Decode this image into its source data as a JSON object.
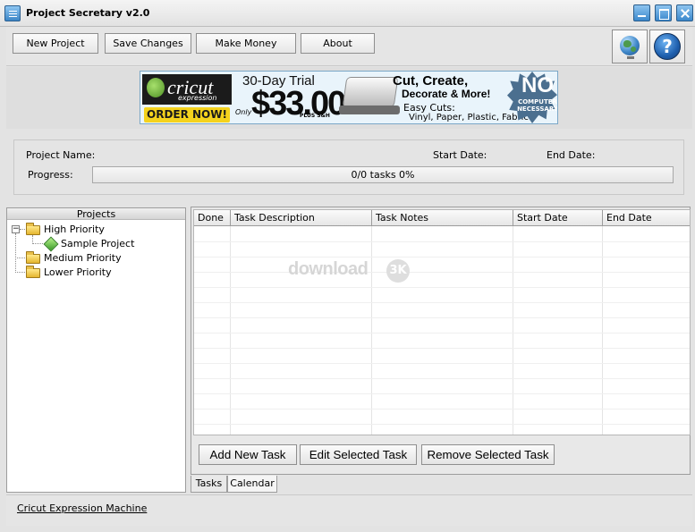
{
  "window": {
    "title": "Project Secretary v2.0"
  },
  "toolbar": {
    "new_project": "New Project",
    "save_changes": "Save Changes",
    "make_money": "Make Money",
    "about": "About",
    "help_glyph": "?",
    "icons": [
      "globe-icon",
      "help-icon"
    ]
  },
  "banner": {
    "brand": "cricut",
    "brand_sub": "expression",
    "order_now": "ORDER NOW!",
    "trial": "30-Day Trial",
    "only": "Only",
    "price": "$33.00",
    "plus": "PLUS S&H",
    "headline": "Cut, Create,",
    "headline2": "Decorate & More!",
    "easy_cuts": "Easy Cuts:",
    "materials": "Vinyl, Paper, Plastic, Fabric",
    "no": "NO",
    "no_computer": "COMPUTER NECESSARY"
  },
  "project_info": {
    "name_label": "Project Name:",
    "start_label": "Start Date:",
    "end_label": "End Date:",
    "progress_label": "Progress:",
    "progress_text": "0/0 tasks  0%",
    "progress_fraction": 0
  },
  "projects_tree": {
    "header": "Projects",
    "expander": "−",
    "groups": [
      {
        "label": "High Priority",
        "children": [
          "Sample Project"
        ]
      },
      {
        "label": "Medium Priority",
        "children": []
      },
      {
        "label": "Lower Priority",
        "children": []
      }
    ]
  },
  "tasks_table": {
    "columns": [
      "Done",
      "Task Description",
      "Task Notes",
      "Start Date",
      "End Date"
    ],
    "rows": []
  },
  "watermark": {
    "text": "download",
    "mark": "3K"
  },
  "task_buttons": {
    "add": "Add New Task",
    "edit": "Edit Selected Task",
    "remove": "Remove Selected Task"
  },
  "tabs": [
    "Tasks",
    "Calendar"
  ],
  "status_bar": {
    "link": "Cricut Expression Machine"
  },
  "colors": {
    "window_bg": "#e3e3e3",
    "titlebar_button": "#3c88cc",
    "folder": "#e4b52e",
    "leaf": "#3c9b2a"
  }
}
